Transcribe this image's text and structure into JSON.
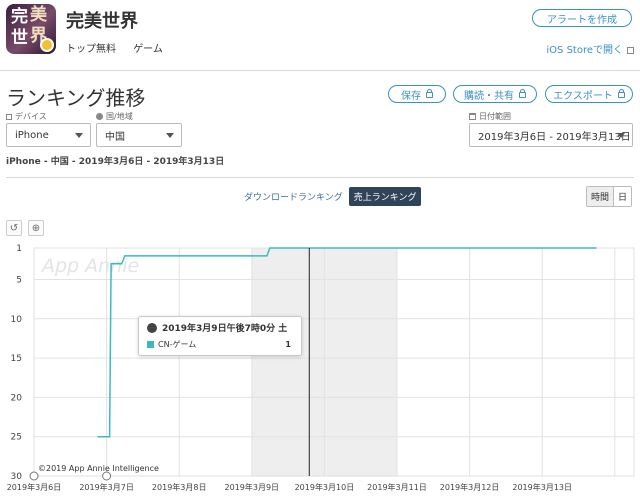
{
  "app": {
    "name": "完美世界",
    "icon_glyphs": [
      "完",
      "美",
      "世",
      "界"
    ],
    "meta": [
      "トップ無料",
      "ゲーム"
    ],
    "alert_button": "アラートを作成",
    "store_link": "iOS Storeで開く"
  },
  "section": {
    "title": "ランキング推移",
    "save": "保存",
    "subscribe_share": "購読・共有",
    "export": "エクスポート"
  },
  "filters": {
    "device_label": "デバイス",
    "device_value": "iPhone",
    "country_label": "国/地域",
    "country_value": "中国",
    "date_label": "日付範囲",
    "date_value": "2019年3月6日 - 2019年3月13日"
  },
  "breadcrumb": "iPhone - 中国 - 2019年3月6日 - 2019年3月13日",
  "toggles": {
    "download": "ダウンロードランキング",
    "revenue": "売上ランキング"
  },
  "period": [
    "時間",
    "日"
  ],
  "zoom_icons": [
    "undo-icon",
    "zoom-icon"
  ],
  "tooltip": {
    "date": "2019年3月9日午後7時0分 土",
    "series": "CN-ゲーム",
    "value": "1"
  },
  "copyright": "©2019 App Annie Intelligence",
  "watermark": "App Annie",
  "colors": {
    "accent": "#3d8fc6",
    "series": "#3fb7c3",
    "toggle_active": "#2f4459"
  },
  "chart_data": {
    "type": "line",
    "x_ticks": [
      "2019年3月6日",
      "2019年3月7日",
      "2019年3月8日",
      "2019年3月9日",
      "2019年3月10日",
      "2019年3月11日",
      "2019年3月12日",
      "2019年3月13日"
    ],
    "y_ticks": [
      1,
      5,
      10,
      15,
      20,
      25,
      30
    ],
    "ylim": [
      1,
      30
    ],
    "y_inverted": true,
    "series": [
      {
        "name": "CN-ゲーム",
        "points": [
          [
            "2019-03-06 21:00",
            25
          ],
          [
            "2019-03-07 01:00",
            25
          ],
          [
            "2019-03-07 01:30",
            3
          ],
          [
            "2019-03-07 05:00",
            3
          ],
          [
            "2019-03-07 06:00",
            2
          ],
          [
            "2019-03-09 05:00",
            2
          ],
          [
            "2019-03-09 06:00",
            1
          ],
          [
            "2019-03-13 18:00",
            1
          ]
        ]
      }
    ],
    "shaded_days": [
      "2019年3月9日",
      "2019年3月10日"
    ],
    "hover_x": "2019-03-09 19:00"
  }
}
